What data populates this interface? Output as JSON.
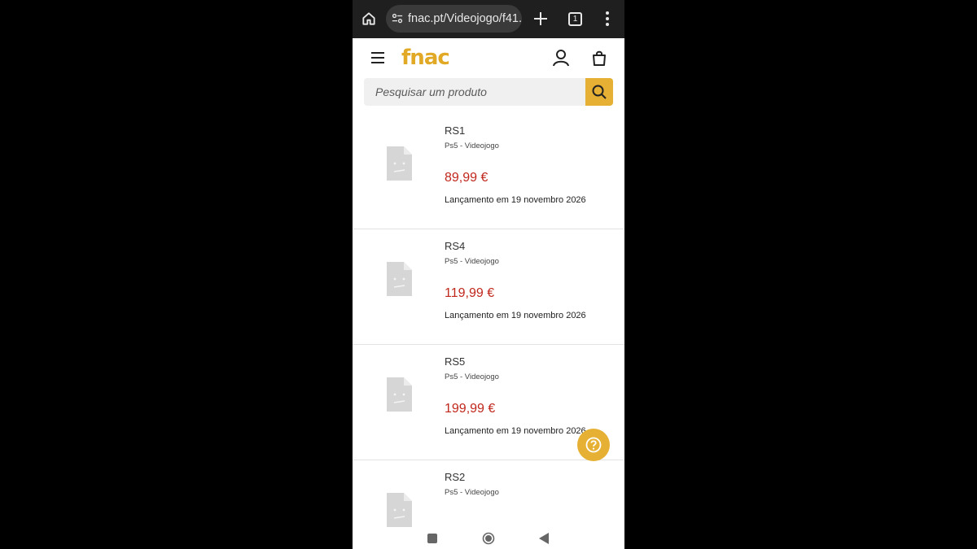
{
  "browser": {
    "url": "fnac.pt/Videojogo/f41...",
    "tab_count": "1"
  },
  "header": {
    "logo": "fnac"
  },
  "search": {
    "placeholder": "Pesquisar um produto"
  },
  "products": [
    {
      "name": "RS1",
      "category": "Ps5 - Videojogo",
      "price": "89,99 €",
      "release": "Lançamento em 19 novembro 2026"
    },
    {
      "name": "RS4",
      "category": "Ps5 - Videojogo",
      "price": "119,99 €",
      "release": "Lançamento em 19 novembro 2026"
    },
    {
      "name": "RS5",
      "category": "Ps5 - Videojogo",
      "price": "199,99 €",
      "release": "Lançamento em 19 novembro 2026"
    },
    {
      "name": "RS2",
      "category": "Ps5 - Videojogo",
      "price": "",
      "release": ""
    }
  ],
  "colors": {
    "brand": "#e1a925",
    "price": "#c0271c",
    "chrome_bg": "#1f1f1f"
  },
  "icons": [
    "home-icon",
    "site-settings-icon",
    "plus-icon",
    "tabs-icon",
    "more-vert-icon",
    "menu-icon",
    "account-icon",
    "cart-icon",
    "search-icon",
    "help-icon",
    "image-placeholder-icon"
  ]
}
